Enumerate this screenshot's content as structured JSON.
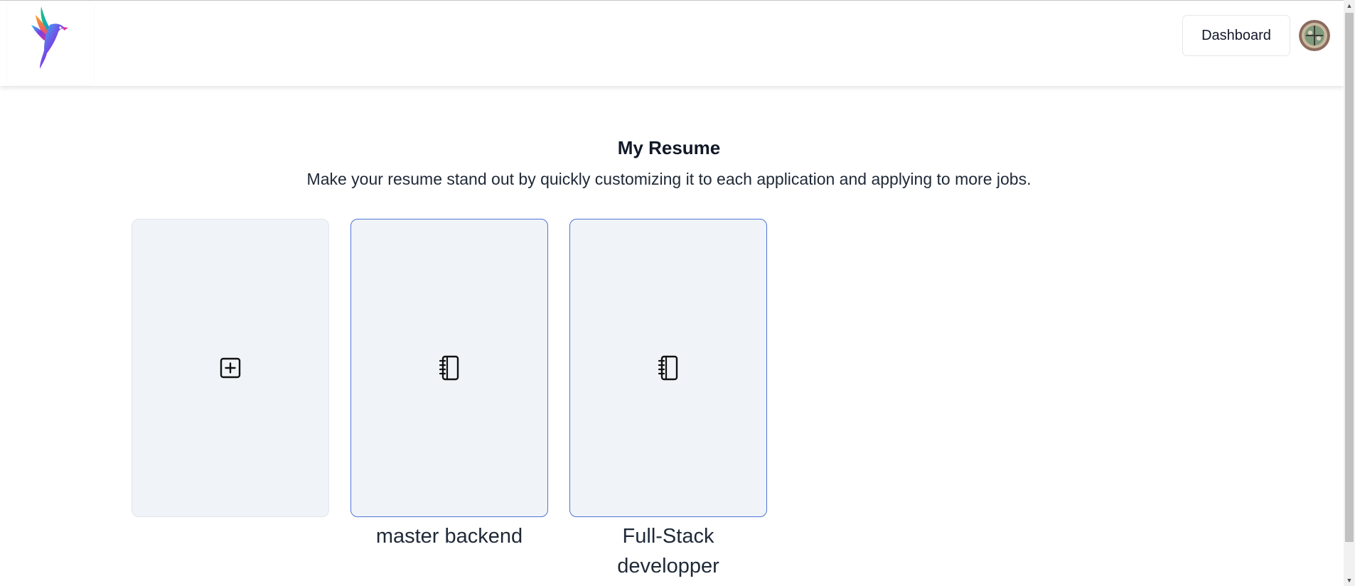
{
  "header": {
    "logo_name": "bird-logo",
    "dashboard_label": "Dashboard",
    "avatar_icon": "user-avatar"
  },
  "main": {
    "title": "My Resume",
    "subtitle": "Make your resume stand out by quickly customizing it to each application and applying to more jobs.",
    "new_card_icon": "plus-square-icon",
    "resumes": [
      {
        "label": "master backend",
        "icon": "notebook-icon"
      },
      {
        "label": "Full-Stack developper",
        "icon": "notebook-icon"
      }
    ]
  },
  "colors": {
    "card_bg": "#f0f3f7",
    "card_border_active": "#4f74d6",
    "text": "#111827"
  }
}
